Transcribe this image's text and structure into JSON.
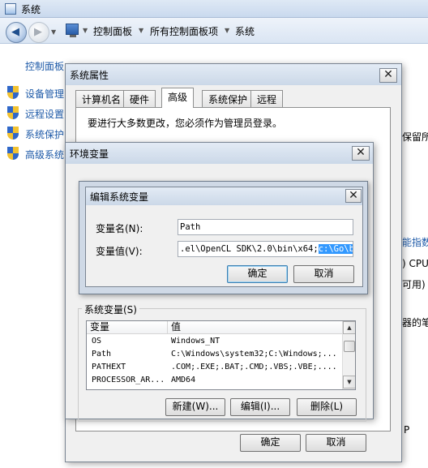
{
  "explorer": {
    "title": "系统",
    "breadcrumb": [
      "控制面板",
      "所有控制面板项",
      "系统"
    ],
    "sidebar": {
      "home_link": "控制面板",
      "items": [
        {
          "label": "设备管理"
        },
        {
          "label": "远程设置"
        },
        {
          "label": "系统保护"
        },
        {
          "label": "高级系统"
        }
      ]
    },
    "background_fragments": {
      "right_1": "保留所",
      "right_2": "能指数",
      "right_3": ") CPU",
      "right_4": "可用)",
      "right_5": "器的笔",
      "right_6": "P"
    }
  },
  "system_properties": {
    "title": "系统属性",
    "tabs": [
      {
        "label": "计算机名",
        "active": false
      },
      {
        "label": "硬件",
        "active": false
      },
      {
        "label": "高级",
        "active": true
      },
      {
        "label": "系统保护",
        "active": false
      },
      {
        "label": "远程",
        "active": false
      }
    ],
    "admin_note": "要进行大多数更改，您必须作为管理员登录。",
    "ok_label": "确定",
    "cancel_label": "取消"
  },
  "env_vars": {
    "title": "环境变量",
    "system_group_label": "系统变量(S)",
    "columns": [
      "变量",
      "值"
    ],
    "rows": [
      {
        "name": "OS",
        "value": "Windows_NT"
      },
      {
        "name": "Path",
        "value": "C:\\Windows\\system32;C:\\Windows;..."
      },
      {
        "name": "PATHEXT",
        "value": ".COM;.EXE;.BAT;.CMD;.VBS;.VBE;...."
      },
      {
        "name": "PROCESSOR_AR...",
        "value": "AMD64"
      }
    ],
    "new_label": "新建(W)...",
    "edit_label": "编辑(I)...",
    "delete_label": "删除(L)"
  },
  "edit_var": {
    "title": "编辑系统变量",
    "name_label": "变量名(N):",
    "value_label": "变量值(V):",
    "name_value": "Path",
    "value_value": ".el\\OpenCL SDK\\2.0\\bin\\x64;",
    "value_selected": "c:\\Go\\bin",
    "ok_label": "确定",
    "cancel_label": "取消"
  },
  "icons": {
    "window": "system-window-icon",
    "back": "back-arrow-icon",
    "forward": "forward-arrow-icon",
    "computer": "control-panel-icon",
    "shield": "uac-shield-icon",
    "close": "close-icon"
  }
}
